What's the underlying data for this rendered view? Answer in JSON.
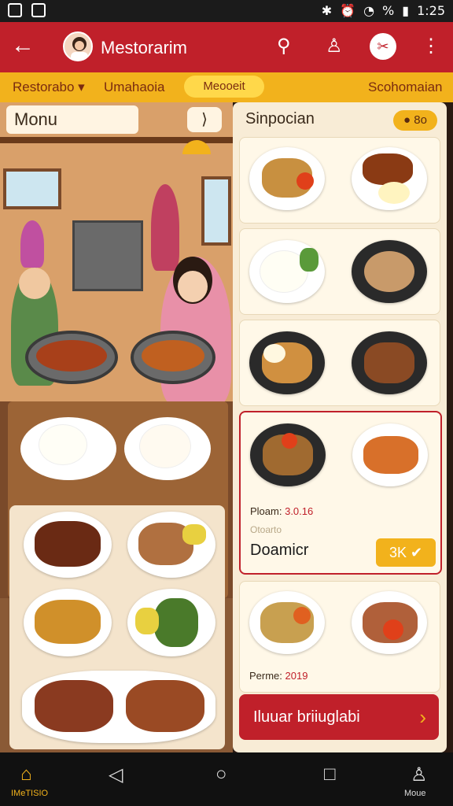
{
  "status_bar": {
    "time": "1:25",
    "battery_text": "%"
  },
  "app_bar": {
    "back_glyph": "←",
    "title": "Mestorarim",
    "search_glyph": "⚲",
    "profile_glyph": "♙",
    "share_glyph": "✂",
    "more_glyph": "⋮"
  },
  "tabs": [
    {
      "label": "Restorabo ▾"
    },
    {
      "label": "Umahaoia"
    },
    {
      "label": "Meooeit"
    },
    {
      "label": "Scohomaian"
    }
  ],
  "left_pane": {
    "search_label": "Monu",
    "expand_glyph": "⟩"
  },
  "right_pane": {
    "title": "Sinpocian",
    "badge": "● 8o",
    "cards": [
      {
        "id": "card1"
      },
      {
        "id": "card2"
      },
      {
        "id": "card3"
      },
      {
        "id": "card4",
        "price_label": "Ploam:",
        "price_value": "3.0.16",
        "sub": "Otoarto",
        "name": "Doamicr",
        "qty": "3K ✔"
      },
      {
        "id": "card5",
        "price_label": "Perme:",
        "price_value": "2019"
      }
    ],
    "cta_label": "Iluuar briiuglabi",
    "cta_glyph": "›"
  },
  "nav_bar": {
    "home_label": "IMeTISIO",
    "back_glyph": "◁",
    "home_glyph": "○",
    "recent_glyph": "□",
    "profile_label": "Moue"
  },
  "colors": {
    "primary": "#c0202a",
    "accent": "#f2b21c",
    "panel": "#f8ecd6"
  }
}
